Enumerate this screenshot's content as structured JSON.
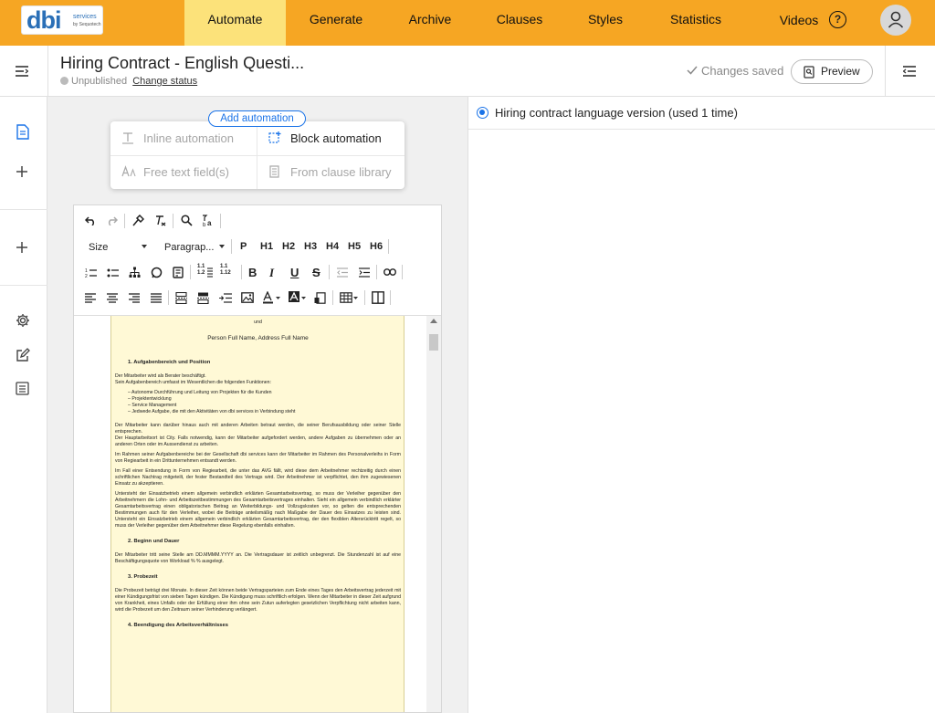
{
  "brand": {
    "logo_text": "dbi",
    "logo_sub1": "services",
    "logo_sub2": "by Sequotech"
  },
  "nav": {
    "items": [
      {
        "label": "Automate",
        "active": true
      },
      {
        "label": "Generate"
      },
      {
        "label": "Archive"
      },
      {
        "label": "Clauses"
      },
      {
        "label": "Styles"
      },
      {
        "label": "Statistics"
      },
      {
        "label": "Videos"
      }
    ],
    "help_glyph": "?"
  },
  "header": {
    "title": "Hiring Contract - English Questi...",
    "status": "Unpublished",
    "status_link": "Change status",
    "saved": "Changes saved",
    "preview": "Preview"
  },
  "automation": {
    "add_label": "Add automation",
    "inline": "Inline automation",
    "block": "Block automation",
    "free_text": "Free text field(s)",
    "from_library": "From clause library"
  },
  "toolbar": {
    "size": "Size",
    "paragraph": "Paragrap...",
    "p": "P",
    "h1": "H1",
    "h2": "H2",
    "h3": "H3",
    "h4": "H4",
    "h5": "H5",
    "h6": "H6",
    "b": "B",
    "i": "I",
    "u": "U",
    "s": "S",
    "list_num1": "1.1",
    "list_num2": "1.2",
    "list_num3": "1.1",
    "list_num4": "1.12"
  },
  "document": {
    "und": "und",
    "person": "Person Full Name, Address Full Name",
    "s1_title": "1.      Aufgabenbereich und Position",
    "s1_p1a": "Der Mitarbeiter wird als Berater beschäftigt.",
    "s1_p1b": "Sein Aufgabenbereich umfasst im Wesentlichen die folgenden Funktionen:",
    "s1_list": [
      "Autonome Durchführung und Leitung von Projekten für die Kunden",
      "Projektentwicklung",
      "Service Management",
      "Jedwede Aufgabe, die mit den Aktivitäten von dbi services in Verbindung steht"
    ],
    "s1_p2": "Der Mitarbeiter kann darüber hinaus auch mit anderen Arbeiten betraut werden, die seiner Berufsausbildung oder seiner Stelle entsprechen.",
    "s1_p3": "Der Hauptarbeitsort ist City. Falls notwendig, kann der Mitarbeiter aufgefordert werden, andere Aufgaben zu übernehmen oder an anderen Orten oder im Aussendienst zu arbeiten.",
    "s1_p4": "Im Rahmen seiner Aufgabenbereiche bei der Gesellschaft dbi services kann der Mitarbeiter im Rahmen des Personalverleihs in Form von Regiearbeit in ein Drittunternehmen entsandt werden.",
    "s1_p5": "Im Fall einer Entsendung in Form von Regiearbeit, die unter das AVG fällt, wird diese dem Arbeitnehmer rechtzeitig durch einen schriftlichen Nachtrag mitgeteilt, der fester Bestandteil des Vertrags wird. Der Arbeitnehmer ist verpflichtet, den ihm zugewiesenen Einsatz zu akzeptieren.",
    "s1_p6": "Untersteht der Einsatzbetrieb einem allgemein verbindlich erklärten Gesamtarbeitsvertrag, so muss der Verleiher gegenüber den Arbeitnehmern die Lohn- und Arbeitszeitbestimmungen des Gesamtarbeitsvertrages einhalten. Sieht ein allgemein verbindlich erklärter Gesamtarbeitsvertrag einen obligatorischen Beitrag an Weiterbildungs- und Vollzugskosten vor, so gelten die entsprechenden Bestimmungen auch für den Verleiher, wobei die Beiträge anteilsmäßig nach Maßgabe der Dauer des Einsatzes zu leisten sind. Untersteht ein Einsatzbetrieb einem allgemein verbindlich erklärten Gesamtarbeitsvertrag, der den flexiblen Altersrücktritt regelt, so muss der Verleiher gegenüber dem Arbeitnehmer diese Regelung ebenfalls einhalten.",
    "s2_title": "2.      Beginn und Dauer",
    "s2_p1": "Der Mitarbeiter tritt seine Stelle am DD.MMMM.YYYY an. Die Vertragsdauer ist zeitlich unbegrenzt. Die Stundenzahl ist auf eine Beschäftigungsquote von Workload % % ausgelegt.",
    "s3_title": "3.      Probezeit",
    "s3_p1": "Die Probezeit beträgt drei Monate. In dieser Zeit können beide Vertragsparteien zum Ende eines Tages den Arbeitsvertrag jederzeit mit einer Kündigungsfrist von sieben Tagen kündigen. Die Kündigung muss schriftlich erfolgen. Wenn der Mitarbeiter in dieser Zeit aufgrund von Krankheit, eines Unfalls oder der Erfüllung einer ihm ohne sein Zutun auferlegten gesetzlichen Verpflichtung nicht arbeiten kann, wird die Probezeit um den Zeitraum seiner Verhinderung verlängert.",
    "s4_title": "4.      Beendigung des Arbeitsverhältnisses"
  },
  "right_panel": {
    "option_label": "Hiring contract language version (used 1 time)"
  },
  "colors": {
    "brand_orange": "#f6a623",
    "active_tab": "#fce27a",
    "accent_blue": "#1a73e8",
    "page_yellow": "#fff9d6"
  }
}
